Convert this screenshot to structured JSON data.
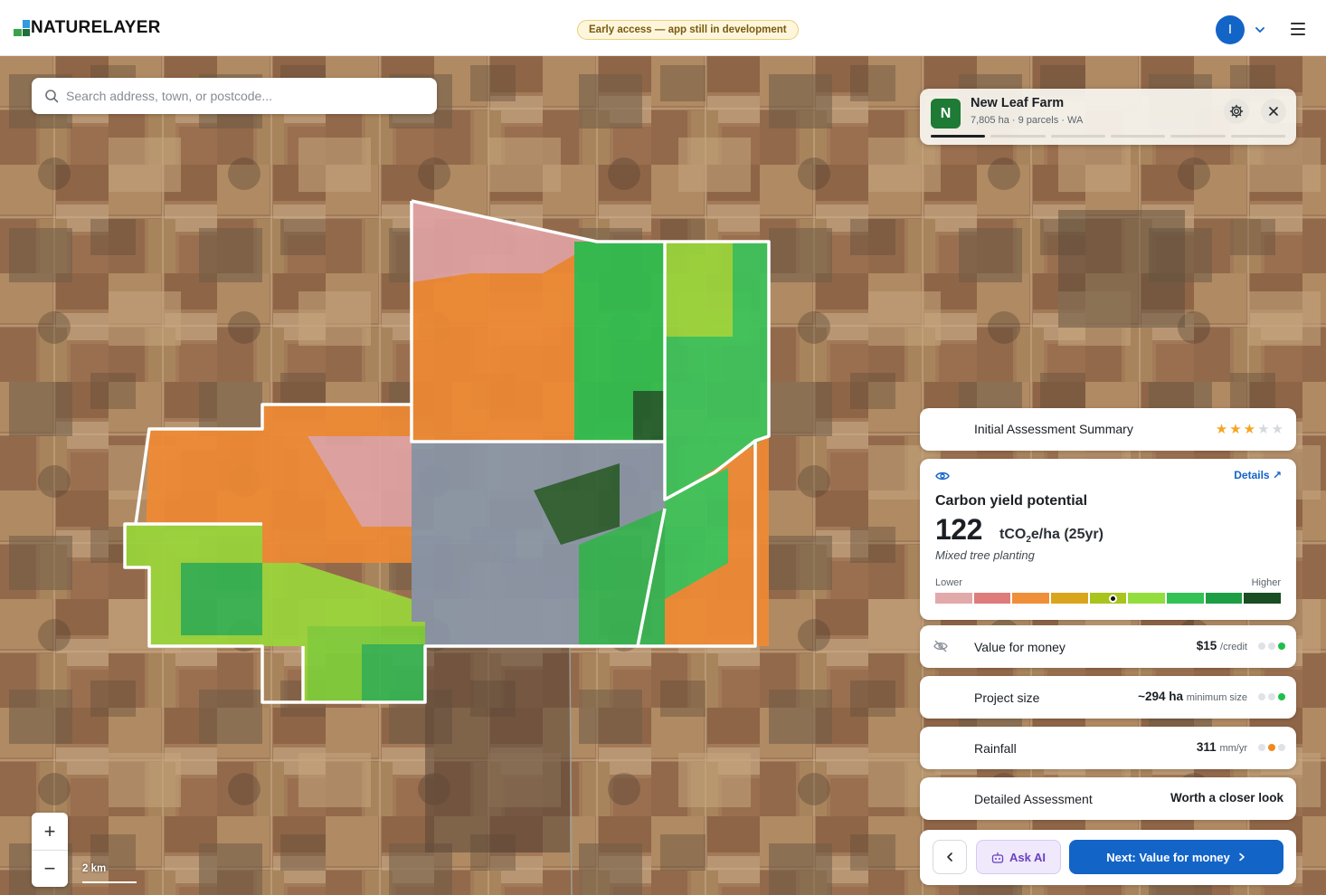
{
  "header": {
    "logo_text": "NATURELAYER",
    "dev_notice": "Early access — app still in development",
    "avatar_initial": "I"
  },
  "search": {
    "placeholder": "Search address, town, or postcode..."
  },
  "farm": {
    "badge": "N",
    "name": "New Leaf Farm",
    "meta": "7,805 ha · 9 parcels · WA",
    "progress_steps": 6,
    "progress_active": 1
  },
  "summary": {
    "label": "Initial Assessment Summary",
    "rating": 3,
    "rating_max": 5
  },
  "carbon": {
    "details_label": "Details",
    "title": "Carbon yield potential",
    "value": "122",
    "unit_prefix": "tCO",
    "unit_sub": "2",
    "unit_suffix": "e/ha (25yr)",
    "subtitle": "Mixed tree planting",
    "scale_low": "Lower",
    "scale_high": "Higher",
    "scale_colors": [
      "#e2a9ab",
      "#de7c7c",
      "#ef8f3a",
      "#d9a51c",
      "#a8c41d",
      "#93dd3e",
      "#34c257",
      "#1e9e44",
      "#194d22"
    ],
    "marker_position": 0.515
  },
  "metrics": [
    {
      "label": "Value for money",
      "value": "$15",
      "unit": "/credit",
      "rating": 3
    },
    {
      "label": "Project size",
      "value": "~294 ha",
      "unit": "minimum size",
      "rating": 3
    },
    {
      "label": "Rainfall",
      "value": "311",
      "unit": "mm/yr",
      "rating": 2
    }
  ],
  "detailed": {
    "label": "Detailed Assessment",
    "value": "Worth a closer look"
  },
  "actions": {
    "ask_ai": "Ask AI",
    "next": "Next: Value for money"
  },
  "map": {
    "scale_label": "2 km"
  },
  "colors": {
    "brand_blue": "#1364c7",
    "good_green": "#1fbf4a",
    "mid_orange": "#f08a1c",
    "star_gold": "#f5a524"
  }
}
